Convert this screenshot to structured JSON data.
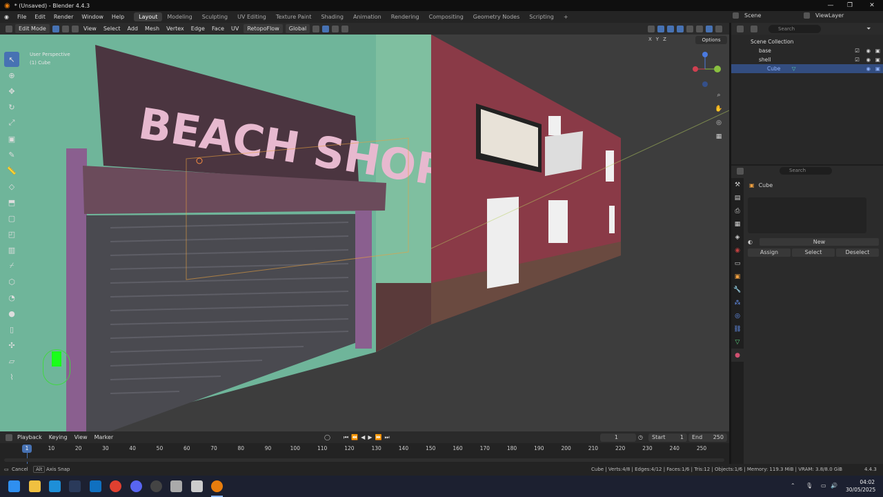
{
  "window": {
    "title": "* (Unsaved) - Blender 4.4.3"
  },
  "menu": {
    "items": [
      "File",
      "Edit",
      "Render",
      "Window",
      "Help"
    ]
  },
  "workspaces": {
    "tabs": [
      "Layout",
      "Modeling",
      "Sculpting",
      "UV Editing",
      "Texture Paint",
      "Shading",
      "Animation",
      "Rendering",
      "Compositing",
      "Geometry Nodes",
      "Scripting"
    ],
    "active": "Layout",
    "add": "+"
  },
  "scene": {
    "label": "Scene",
    "view_layer": "ViewLayer"
  },
  "viewport_header": {
    "mode": "Edit Mode",
    "menus": [
      "View",
      "Select",
      "Add",
      "Mesh",
      "Vertex",
      "Edge",
      "Face",
      "UV"
    ],
    "retopo": "RetopoFlow",
    "orientation": "Global",
    "options": "Options",
    "axes": [
      "X",
      "Y",
      "Z"
    ]
  },
  "viewport": {
    "perspective": "User Perspective",
    "object": "(1) Cube",
    "sign_text": "BEACH SHOP"
  },
  "outliner": {
    "search_placeholder": "Search",
    "collection": "Scene Collection",
    "items": [
      {
        "name": "base",
        "selected": false
      },
      {
        "name": "shell",
        "selected": false
      },
      {
        "name": "Cube",
        "selected": true
      }
    ]
  },
  "properties": {
    "search_placeholder": "Search",
    "object_name": "Cube",
    "new_label": "New",
    "buttons": [
      "Assign",
      "Select",
      "Deselect"
    ]
  },
  "timeline": {
    "menus": [
      "Playback",
      "Keying",
      "View",
      "Marker"
    ],
    "current_frame": "1",
    "start_label": "Start",
    "start": "1",
    "end_label": "End",
    "end": "250",
    "ticks": [
      "10",
      "20",
      "30",
      "40",
      "50",
      "60",
      "70",
      "80",
      "90",
      "100",
      "110",
      "120",
      "130",
      "140",
      "150",
      "160",
      "170",
      "180",
      "190",
      "200",
      "210",
      "220",
      "230",
      "240",
      "250"
    ],
    "playhead": "1"
  },
  "status": {
    "cancel": "Cancel",
    "alt": "Alt",
    "axis_snap": "Axis Snap",
    "stats": "Cube | Verts:4/8 | Edges:4/12 | Faces:1/6 | Tris:12 | Objects:1/6 | Memory: 119.3 MiB | VRAM: 3.8/8.0 GiB",
    "version": "4.4.3"
  },
  "taskbar": {
    "time": "04:02",
    "date": "30/05/2025"
  },
  "colors": {
    "accent": "#4772b3",
    "selected_row": "#334d80",
    "wall_green": "#6fb59a",
    "wall_red": "#8a3a47"
  }
}
